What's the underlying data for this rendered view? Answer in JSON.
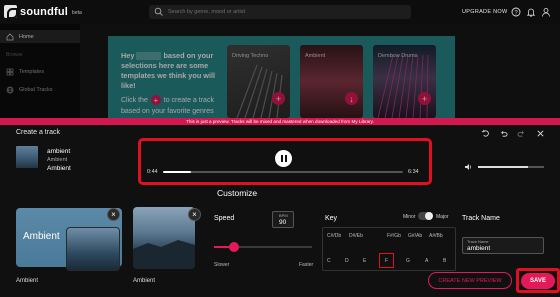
{
  "app": {
    "name": "soundful",
    "badge": "beta"
  },
  "search": {
    "placeholder": "Search by genre, mood or artist"
  },
  "header": {
    "upgrade_label": "UPGRADE NOW"
  },
  "sidebar": {
    "items": [
      {
        "label": "Home",
        "icon": "home-icon",
        "active": true
      },
      {
        "label": "Templates",
        "icon": "grid-icon"
      },
      {
        "label": "Global Tracks",
        "icon": "globe-icon"
      }
    ],
    "section_label": "Browse"
  },
  "banner": {
    "line1_a": "Hey",
    "line1_b": "based on your selections here are some templates we think you will like!",
    "line2_a": "Click the",
    "line2_b": "to create a track based on your favorite genres"
  },
  "cards": [
    {
      "title": "Driving Techno"
    },
    {
      "title": "Ambient"
    },
    {
      "title": "Dembow Drums"
    }
  ],
  "notice": "This is just a preview. Tracks will be mixed and mastered when downloaded from My Library.",
  "modal": {
    "title": "Create a track",
    "track": {
      "name": "ambient",
      "style": "Ambient",
      "genre": "Ambient"
    },
    "player": {
      "current_time": "0:44",
      "total_time": "6:34",
      "progress": 0.117,
      "volume": 0.75
    },
    "customize_label": "Customize",
    "styles": [
      {
        "label": "Ambient",
        "caption": "Ambient"
      },
      {
        "caption": "Ambient"
      }
    ],
    "speed": {
      "label": "Speed",
      "bpm_caption": "BPM",
      "bpm": "90",
      "slower": "Slower",
      "faster": "Faster",
      "level": 0.2
    },
    "key": {
      "label": "Key",
      "minor": "Minor",
      "major": "Major",
      "sharps": [
        "C#/Db",
        "D#/Eb",
        "F#/Gb",
        "G#/Ab",
        "A#/Bb"
      ],
      "naturals": [
        "C",
        "D",
        "E",
        "F",
        "G",
        "A",
        "B"
      ],
      "selected": "F"
    },
    "track_name": {
      "label": "Track Name",
      "caption": "Track Name",
      "value": "ambient"
    },
    "buttons": {
      "preview": "CREATE NEW PREVIEW",
      "save": "SAVE"
    }
  },
  "colors": {
    "accent": "#e3195a",
    "highlight": "#e10f22",
    "banner": "#2a8a8c"
  }
}
